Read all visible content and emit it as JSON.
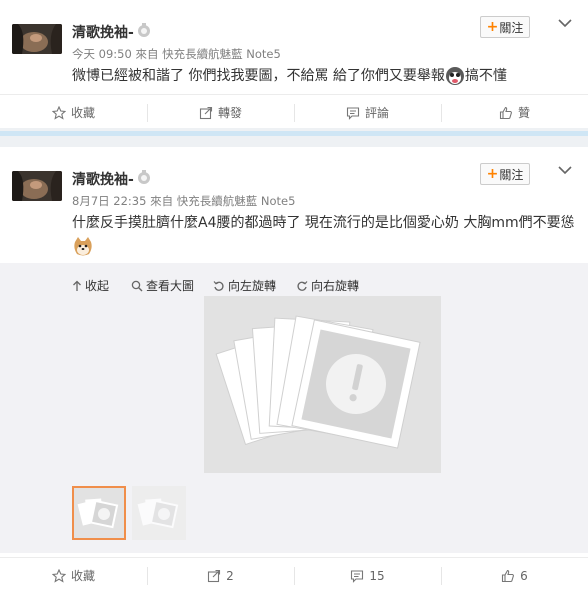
{
  "post1": {
    "name": "清歌挽袖-",
    "meta": "今天 09:50 來自 快充長續航魅藍 Note5",
    "follow_label": "關注",
    "text_a": "微博已經被和諧了  你們找我要圖，不給罵   給了你們又要舉報",
    "text_b": "搞不懂",
    "actions": {
      "fav": "收藏",
      "repost": "轉發",
      "comment": "評論",
      "like": "贊"
    }
  },
  "post2": {
    "name": "清歌挽袖-",
    "meta": "8月7日 22:35 來自 快充長續航魅藍 Note5",
    "follow_label": "關注",
    "text": "什麼反手摸肚臍什麼A4腰的都過時了 現在流行的是比個愛心奶 大胸mm們不要慫",
    "media_tools": {
      "collapse": "收起",
      "view_large": "查看大圖",
      "rotate_left": "向左旋轉",
      "rotate_right": "向右旋轉"
    },
    "actions": {
      "fav": "收藏",
      "repost": "2",
      "comment": "15",
      "like": "6"
    }
  },
  "colors": {
    "accent_orange": "#ff8200",
    "separator_blue": "#cfe6f5",
    "thumb_selected_border": "#f08e4a"
  },
  "icons": [
    "vip-badge-icon",
    "chevron-down-icon",
    "star-icon",
    "repost-icon",
    "comment-icon",
    "thumbs-up-icon",
    "collapse-arrow-icon",
    "magnifier-icon",
    "rotate-left-icon",
    "rotate-right-icon",
    "broken-image-icon"
  ]
}
